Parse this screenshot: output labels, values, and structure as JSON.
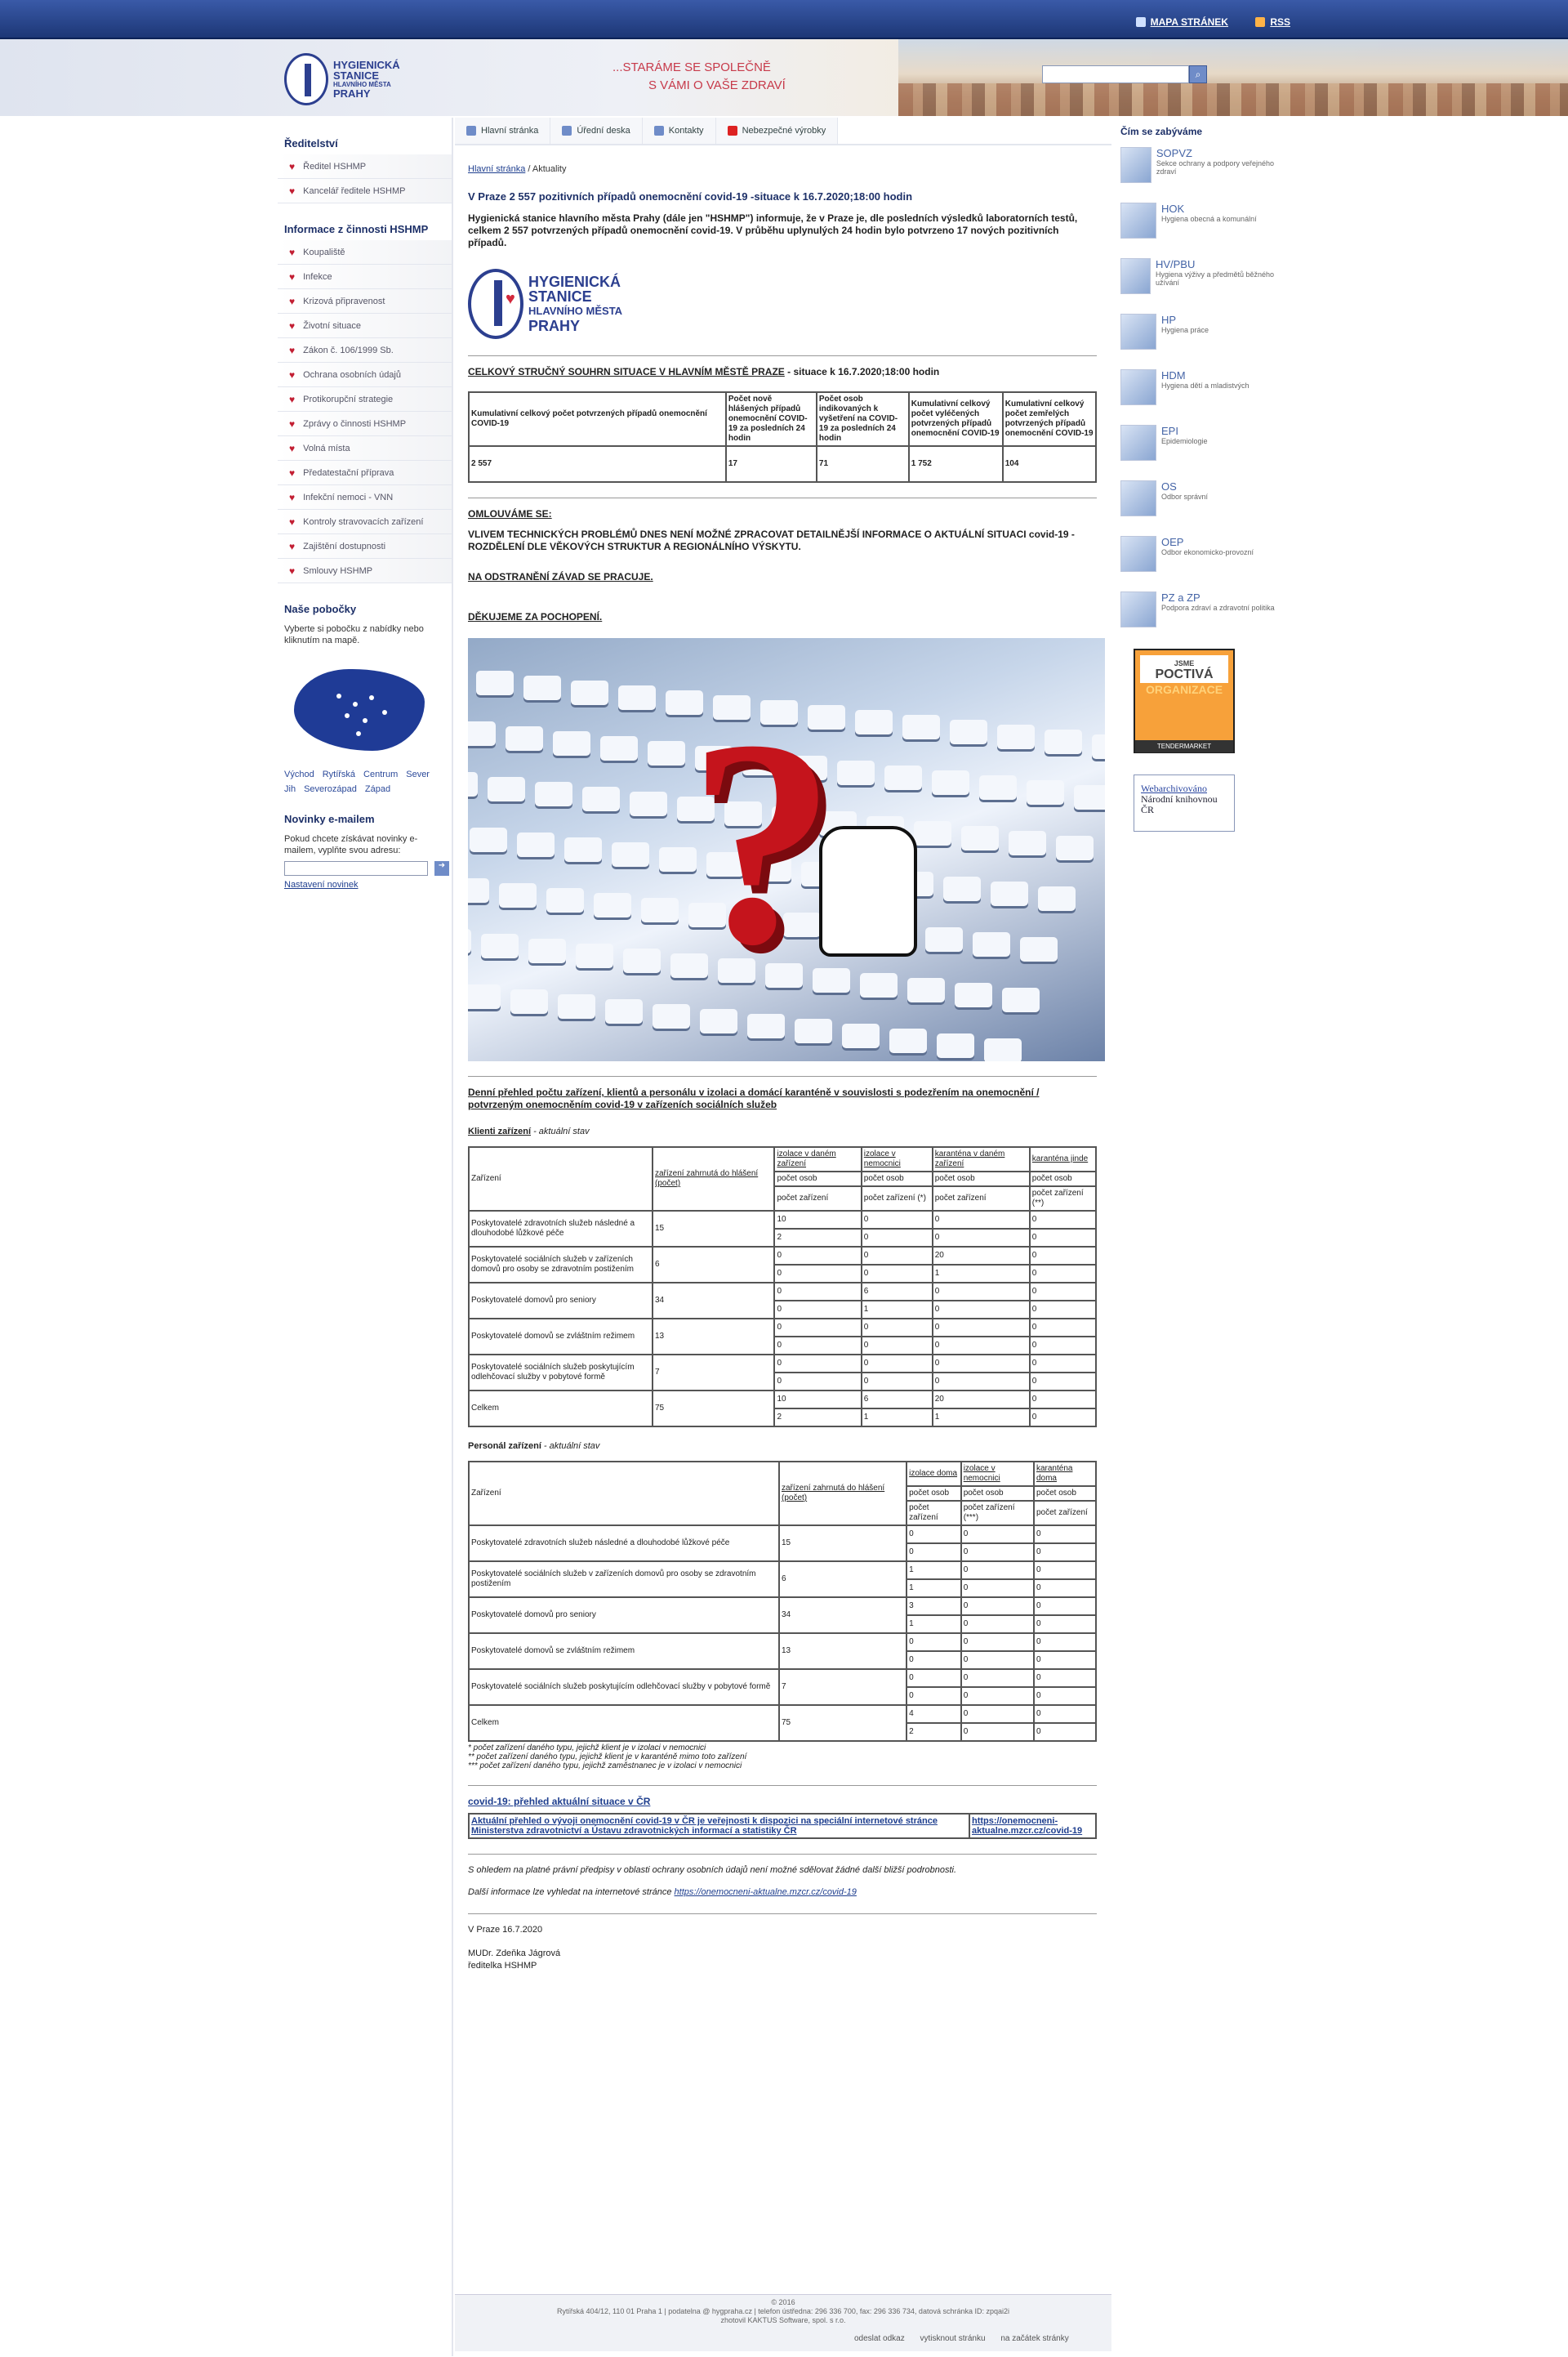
{
  "toplinks": {
    "sitemap": "MAPA STRÁNEK",
    "rss": "RSS"
  },
  "header": {
    "logo_lines": [
      "HYGIENICKÁ",
      "STANICE",
      "HLAVNÍHO MĚSTA",
      "PRAHY"
    ],
    "slogan_line1": "...STARÁME SE SPOLEČNĚ",
    "slogan_line2": "S VÁMI O VAŠE ZDRAVÍ",
    "search_placeholder": ""
  },
  "tabs": [
    {
      "label": "Hlavní stránka"
    },
    {
      "label": "Úřední deska"
    },
    {
      "label": "Kontakty"
    },
    {
      "label": "Nebezpečné výrobky"
    }
  ],
  "left": {
    "reditelstvi_title": "Ředitelství",
    "reditelstvi": [
      "Ředitel HSHMP",
      "Kancelář ředitele HSHMP"
    ],
    "info_title": "Informace z činnosti HSHMP",
    "info": [
      "Koupaliště",
      "Infekce",
      "Krizová připravenost",
      "Životní situace",
      "Zákon č. 106/1999 Sb.",
      "Ochrana osobních údajů",
      "Protikorupční strategie",
      "Zprávy o činnosti HSHMP",
      "Volná místa",
      "Předatestační příprava",
      "Infekční nemoci - VNN",
      "Kontroly stravovacích zařízení",
      "Zajištění dostupnosti",
      "Smlouvy HSHMP"
    ],
    "branches_title": "Naše pobočky",
    "branches_text": "Vyberte si pobočku z nabídky nebo kliknutím na mapě.",
    "regions": [
      "Východ",
      "Rytířská",
      "Centrum",
      "Sever",
      "Jih",
      "Severozápad",
      "Západ"
    ],
    "newsletter_title": "Novinky e-mailem",
    "newsletter_text": "Pokud chcete získávat novinky e-mailem, vyplňte svou adresu:",
    "newsletter_settings": "Nastavení novinek"
  },
  "main": {
    "crumb_home": "Hlavní stránka",
    "crumb_current": "/ Aktuality",
    "title": "V Praze 2 557 pozitivních případů onemocnění covid-19 -situace k 16.7.2020;18:00 hodin",
    "lead": "Hygienická stanice hlavního města Prahy (dále jen \"HSHMP\") informuje, že v Praze je, dle posledních výsledků laboratorních testů, celkem 2 557 potvrzených případů onemocnění covid-19. V průběhu uplynulých 24 hodin bylo potvrzeno 17 nových pozitivních případů.",
    "summary_title": "CELKOVÝ STRUČNÝ SOUHRN SITUACE V HLAVNÍM MĚSTĚ PRAZE",
    "summary_title_suffix": " - situace k 16.7.2020;18:00 hodin",
    "summary_headers": [
      "Kumulativní celkový počet potvrzených případů onemocnění COVID-19",
      "Počet nově hlášených případů onemocnění COVID-19 za posledních 24 hodin",
      "Počet osob indikovaných k vyšetření na COVID-19 za posledních 24 hodin",
      "Kumulativní celkový počet vyléčených potvrzených případů onemocnění COVID-19",
      "Kumulativní celkový počet zemřelých potvrzených případů onemocnění COVID-19"
    ],
    "summary_values": [
      "2 557",
      "17",
      "71",
      "1 752",
      "104"
    ],
    "sorry1": "OMLOUVÁME SE:",
    "sorry2": "VLIVEM TECHNICKÝCH PROBLÉMŮ DNES NENÍ MOŽNÉ ZPRACOVAT DETAILNĚJŠÍ INFORMACE O AKTUÁLNÍ SITUACI covid-19 - ROZDĚLENÍ DLE VĚKOVÝCH STRUKTUR A REGIONÁLNÍHO VÝSKYTU.",
    "sorry3": "NA ODSTRANĚNÍ ZÁVAD SE PRACUJE.",
    "sorry4": "DĚKUJEME ZA POCHOPENÍ.",
    "daily_title": "Denní přehled počtu zařízení, klientů a personálu v izolaci a domácí karanténě v souvislosti s podezřením na onemocnění / potvrzeným onemocněním covid-19 v zařízeních sociálních služeb",
    "clients_label": "Klienti zařízení",
    "clients_suffix": " - aktuální stav",
    "clients_headers": {
      "facility": "Zařízení",
      "count": "zařízení zahrnutá do hlášení (počet)",
      "iso_facility": "izolace v daném zařízení",
      "iso_hospital": "izolace v nemocnici",
      "quar_facility": "karanténa v daném zařízení",
      "quar_else": "karanténa jinde",
      "persons": "počet osob",
      "facilities": "počet zařízení",
      "facilities_a": "počet zařízení (*)",
      "facilities_b": "počet zařízení (**)"
    },
    "clients_rows": [
      {
        "name": "Poskytovatelé zdravotních služeb následné a dlouhodobé lůžkové péče",
        "count": "15",
        "a": [
          "10",
          "2"
        ],
        "b": [
          "0",
          "0"
        ],
        "c": [
          "0",
          "0"
        ],
        "d": [
          "0",
          "0"
        ]
      },
      {
        "name": "Poskytovatelé sociálních služeb v zařízeních domovů pro osoby se zdravotním postižením",
        "count": "6",
        "a": [
          "0",
          "0"
        ],
        "b": [
          "0",
          "0"
        ],
        "c": [
          "20",
          "1"
        ],
        "d": [
          "0",
          "0"
        ]
      },
      {
        "name": "Poskytovatelé domovů pro seniory",
        "count": "34",
        "a": [
          "0",
          "0"
        ],
        "b": [
          "6",
          "1"
        ],
        "c": [
          "0",
          "0"
        ],
        "d": [
          "0",
          "0"
        ]
      },
      {
        "name": "Poskytovatelé domovů se zvláštním režimem",
        "count": "13",
        "a": [
          "0",
          "0"
        ],
        "b": [
          "0",
          "0"
        ],
        "c": [
          "0",
          "0"
        ],
        "d": [
          "0",
          "0"
        ]
      },
      {
        "name": "Poskytovatelé sociálních služeb poskytujícím odlehčovací služby v pobytové formě",
        "count": "7",
        "a": [
          "0",
          "0"
        ],
        "b": [
          "0",
          "0"
        ],
        "c": [
          "0",
          "0"
        ],
        "d": [
          "0",
          "0"
        ]
      },
      {
        "name": "Celkem",
        "count": "75",
        "a": [
          "10",
          "2"
        ],
        "b": [
          "6",
          "1"
        ],
        "c": [
          "20",
          "1"
        ],
        "d": [
          "0",
          "0"
        ]
      }
    ],
    "staff_label": "Personál zařízení",
    "staff_suffix": " - aktuální stav",
    "staff_headers": {
      "facility": "Zařízení",
      "count": "zařízení zahrnutá do hlášení (počet)",
      "iso_home": "izolace doma",
      "iso_hospital": "izolace v nemocnici",
      "quar_home": "karanténa doma",
      "persons": "počet osob",
      "facilities": "počet zařízení",
      "facilities_c": "počet zařízení (***)"
    },
    "staff_rows": [
      {
        "name": "Poskytovatelé zdravotních služeb následné a dlouhodobé lůžkové péče",
        "count": "15",
        "a": [
          "0",
          "0"
        ],
        "b": [
          "0",
          "0"
        ],
        "c": [
          "0",
          "0"
        ]
      },
      {
        "name": "Poskytovatelé sociálních služeb v zařízeních domovů pro osoby se zdravotním postižením",
        "count": "6",
        "a": [
          "1",
          "1"
        ],
        "b": [
          "0",
          "0"
        ],
        "c": [
          "0",
          "0"
        ]
      },
      {
        "name": "Poskytovatelé domovů pro seniory",
        "count": "34",
        "a": [
          "3",
          "1"
        ],
        "b": [
          "0",
          "0"
        ],
        "c": [
          "0",
          "0"
        ]
      },
      {
        "name": "Poskytovatelé domovů se zvláštním režimem",
        "count": "13",
        "a": [
          "0",
          "0"
        ],
        "b": [
          "0",
          "0"
        ],
        "c": [
          "0",
          "0"
        ]
      },
      {
        "name": "Poskytovatelé sociálních služeb poskytujícím odlehčovací služby v pobytové formě",
        "count": "7",
        "a": [
          "0",
          "0"
        ],
        "b": [
          "0",
          "0"
        ],
        "c": [
          "0",
          "0"
        ]
      },
      {
        "name": "Celkem",
        "count": "75",
        "a": [
          "4",
          "2"
        ],
        "b": [
          "0",
          "0"
        ],
        "c": [
          "0",
          "0"
        ]
      }
    ],
    "notes": [
      "* počet zařízení daného typu, jejichž klient je v izolaci v nemocnici",
      "** počet zařízení daného typu, jejichž klient je v karanténě mimo toto zařízení",
      "*** počet zařízení daného typu, jejichž zaměstnanec je v izolaci v nemocnici"
    ],
    "overview_link": "covid-19: přehled aktuální situace v ČR",
    "overview_cell1": "Aktuální přehled o vývoji onemocnění covid-19 v ČR je veřejnosti k dispozici na speciální internetové stránce Ministerstva zdravotnictví a Ústavu zdravotnických informací a statistiky ČR",
    "overview_cell2": "https://onemocneni-aktualne.mzcr.cz/covid-19",
    "privacy": "S ohledem na platné právní předpisy v oblasti ochrany osobních údajů není možné sdělovat žádné další bližší podrobnosti.",
    "more_info": "Další informace lze vyhledat na internetové stránce ",
    "more_info_link": "https://onemocneni-aktualne.mzcr.cz/covid-19",
    "place_date": "V Praze 16.7.2020",
    "signature_name": "MUDr. Zdeňka Jágrová",
    "signature_role": "ředitelka HSHMP"
  },
  "right": {
    "title": "Čím se zabýváme",
    "items": [
      {
        "title": "SOPVZ",
        "sub": "Sekce ochrany a podpory veřejného zdraví"
      },
      {
        "title": "HOK",
        "sub": "Hygiena obecná a komunální"
      },
      {
        "title": "HV/PBU",
        "sub": "Hygiena výživy a předmětů běžného užívání"
      },
      {
        "title": "HP",
        "sub": "Hygiena práce"
      },
      {
        "title": "HDM",
        "sub": "Hygiena dětí a mladistvých"
      },
      {
        "title": "EPI",
        "sub": "Epidemiologie"
      },
      {
        "title": "OS",
        "sub": "Odbor správní"
      },
      {
        "title": "OEP",
        "sub": "Odbor ekonomicko-provozní"
      },
      {
        "title": "PZ a ZP",
        "sub": "Podpora zdraví a zdravotní politika"
      }
    ],
    "badge_line1": "JSME",
    "badge_line2": "POCTIVÁ",
    "badge_line3": "ORGANIZACE",
    "badge_footer": "TENDERMARKET",
    "webarchive_link": "Webarchivováno",
    "webarchive_text": "Národní knihovnou ČR"
  },
  "footer": {
    "copyright": "© 2016",
    "address": "Rytířská 404/12, 110 01 Praha 1 | podatelna @ hygpraha.cz | telefon ústředna: 296 336 700, fax: 296 336 734, datová schránka ID: zpqai2i",
    "made_by": "zhotovil KAKTUS Software, spol. s r.o.",
    "send_link": "odeslat odkaz",
    "print": "vytisknout stránku",
    "top": "na začátek stránky"
  }
}
